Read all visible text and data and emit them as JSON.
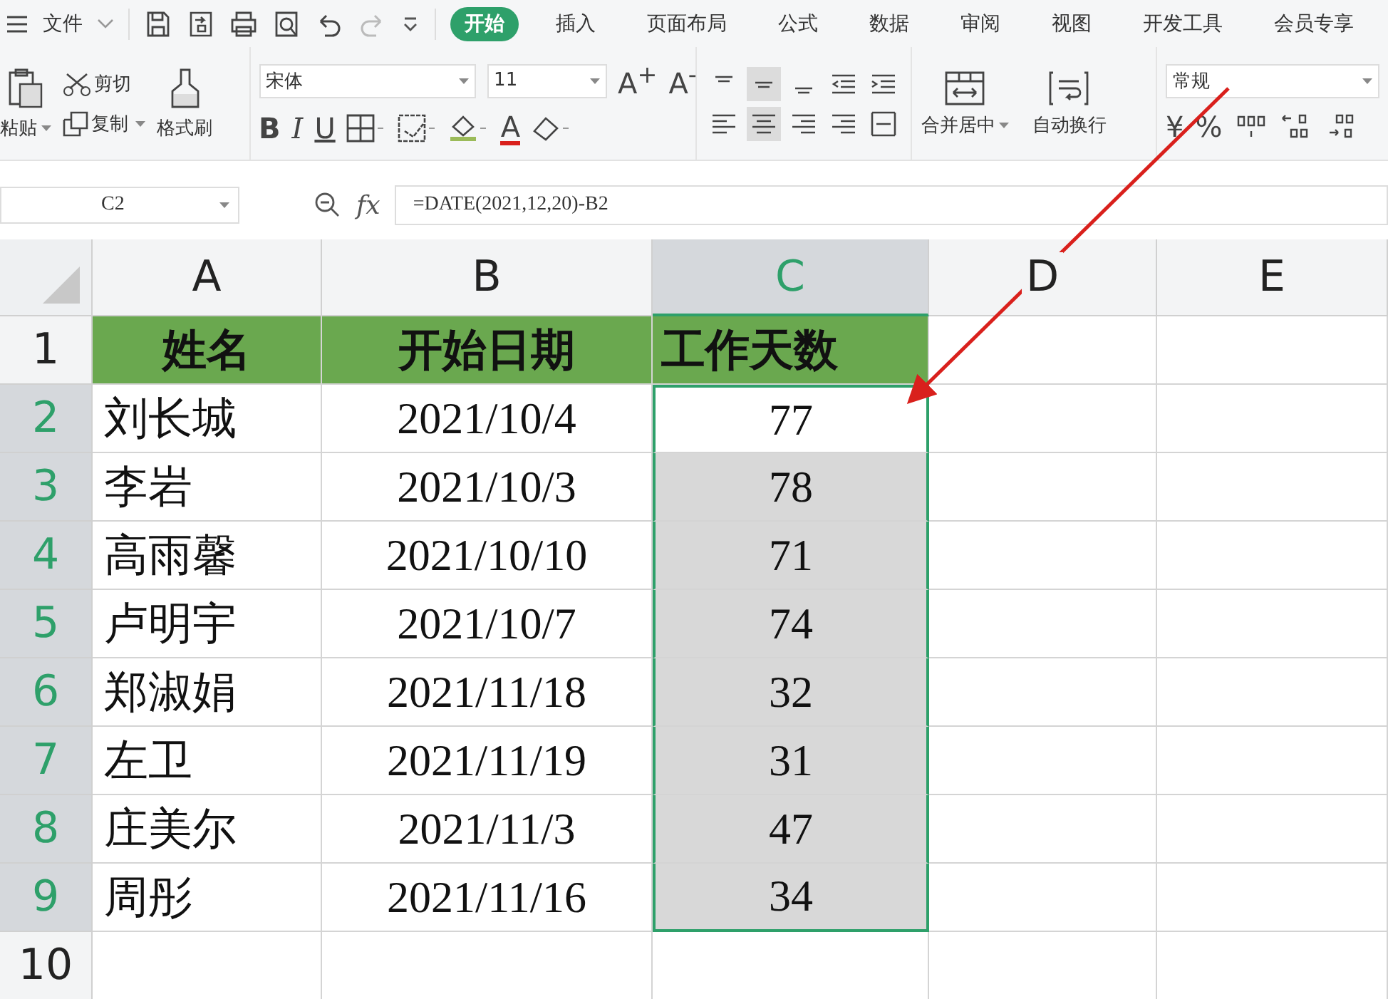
{
  "menu": {
    "file_label": "文件",
    "tabs": [
      {
        "label": "开始",
        "selected": true
      },
      {
        "label": "插入",
        "selected": false
      },
      {
        "label": "页面布局",
        "selected": false
      },
      {
        "label": "公式",
        "selected": false
      },
      {
        "label": "数据",
        "selected": false
      },
      {
        "label": "审阅",
        "selected": false
      },
      {
        "label": "视图",
        "selected": false
      },
      {
        "label": "开发工具",
        "selected": false
      },
      {
        "label": "会员专享",
        "selected": false
      }
    ]
  },
  "ribbon": {
    "paste": "粘贴",
    "cut": "剪切",
    "copy": "复制",
    "format_painter": "格式刷",
    "font_name": "宋体",
    "font_size": "11",
    "grow_font": "A$^{+}$",
    "shrink_font": "A$^{-}$",
    "bold": "B",
    "italic": "I",
    "underline": "U",
    "font_color": "A",
    "align_top_row": [
      {
        "selected": false
      },
      {
        "selected": true
      },
      {
        "selected": false
      },
      {
        "selected": false
      },
      {
        "selected": false
      }
    ],
    "align_bottom_row": [
      {
        "selected": false
      },
      {
        "selected": true
      },
      {
        "selected": false
      },
      {
        "selected": false
      },
      {
        "selected": false
      }
    ],
    "merge": "合并居中",
    "wrap": "自动换行",
    "number_format": "常规",
    "currency": "¥",
    "percent": "%"
  },
  "formula_bar": {
    "name_box": "C2",
    "fx": "fx",
    "formula": "=DATE(2021,12,20)-B2"
  },
  "sheet": {
    "columns": [
      {
        "label": "A",
        "selected": false
      },
      {
        "label": "B",
        "selected": false
      },
      {
        "label": "C",
        "selected": true
      },
      {
        "label": "D",
        "selected": false
      },
      {
        "label": "E",
        "selected": false
      }
    ],
    "rows": [
      {
        "number": "1",
        "kind": "header",
        "selected": false,
        "cells": [
          "姓名",
          "开始日期",
          "工作天数"
        ]
      },
      {
        "number": "2",
        "kind": "data",
        "selected": true,
        "cells": [
          "刘长城",
          "2021/10/4",
          "77"
        ]
      },
      {
        "number": "3",
        "kind": "data",
        "selected": true,
        "cells": [
          "李岩",
          "2021/10/3",
          "78"
        ]
      },
      {
        "number": "4",
        "kind": "data",
        "selected": true,
        "cells": [
          "高雨馨",
          "2021/10/10",
          "71"
        ]
      },
      {
        "number": "5",
        "kind": "data",
        "selected": true,
        "cells": [
          "卢明宇",
          "2021/10/7",
          "74"
        ]
      },
      {
        "number": "6",
        "kind": "data",
        "selected": true,
        "cells": [
          "郑淑娟",
          "2021/11/18",
          "32"
        ]
      },
      {
        "number": "7",
        "kind": "data",
        "selected": true,
        "cells": [
          "左卫",
          "2021/11/19",
          "31"
        ]
      },
      {
        "number": "8",
        "kind": "data",
        "selected": true,
        "cells": [
          "庄美尔",
          "2021/11/3",
          "47"
        ]
      },
      {
        "number": "9",
        "kind": "data",
        "selected": true,
        "cells": [
          "周彤",
          "2021/11/16",
          "34"
        ]
      },
      {
        "number": "10",
        "kind": "empty",
        "selected": false,
        "cells": []
      }
    ]
  }
}
